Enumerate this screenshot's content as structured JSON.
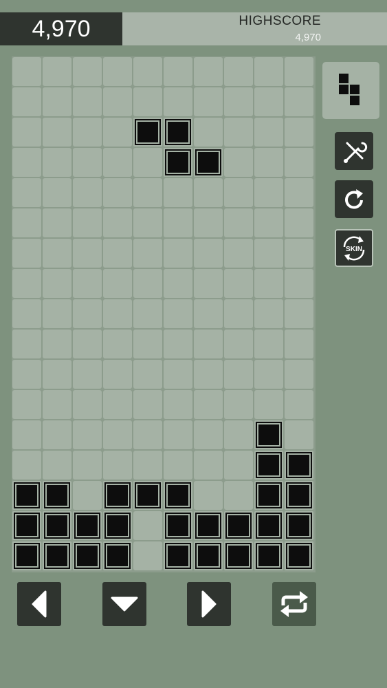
{
  "score": {
    "value": "4,970"
  },
  "highscore": {
    "label": "HIGHSCORE",
    "value": "4,970"
  },
  "board": {
    "columns": 10,
    "rows": 17,
    "filled_cells": [
      [
        3,
        4
      ],
      [
        3,
        5
      ],
      [
        4,
        5
      ],
      [
        4,
        6
      ],
      [
        13,
        8
      ],
      [
        14,
        8
      ],
      [
        14,
        9
      ],
      [
        15,
        0
      ],
      [
        15,
        1
      ],
      [
        15,
        3
      ],
      [
        15,
        4
      ],
      [
        15,
        5
      ],
      [
        15,
        8
      ],
      [
        15,
        9
      ],
      [
        16,
        0
      ],
      [
        16,
        1
      ],
      [
        16,
        2
      ],
      [
        16,
        3
      ],
      [
        16,
        5
      ],
      [
        16,
        6
      ],
      [
        16,
        7
      ],
      [
        16,
        8
      ],
      [
        16,
        9
      ],
      [
        17,
        0
      ],
      [
        17,
        1
      ],
      [
        17,
        2
      ],
      [
        17,
        3
      ],
      [
        17,
        5
      ],
      [
        17,
        6
      ],
      [
        17,
        7
      ],
      [
        17,
        8
      ],
      [
        17,
        9
      ]
    ]
  },
  "next_piece": {
    "name": "S-vertical",
    "cells": [
      [
        0,
        0
      ],
      [
        1,
        0
      ],
      [
        1,
        1
      ],
      [
        2,
        1
      ]
    ]
  },
  "side_buttons": [
    {
      "name": "settings-button",
      "icon": "wrench-screwdriver-icon"
    },
    {
      "name": "restart-button",
      "icon": "restart-arrow-icon"
    },
    {
      "name": "skin-button",
      "icon": "skin-swap-icon",
      "label": "SKIN"
    }
  ],
  "controls": [
    {
      "name": "move-left-button",
      "icon": "triangle-left-icon"
    },
    {
      "name": "drop-down-button",
      "icon": "triangle-down-icon"
    },
    {
      "name": "move-right-button",
      "icon": "triangle-right-icon"
    },
    {
      "name": "rotate-button",
      "icon": "rotate-arrows-icon"
    }
  ],
  "colors": {
    "background": "#7e927e",
    "cell_empty": "#a5b2a5",
    "block": "#0d0d0d",
    "score_bg": "#2f342f",
    "highscore_bg": "#a9b4a9"
  }
}
